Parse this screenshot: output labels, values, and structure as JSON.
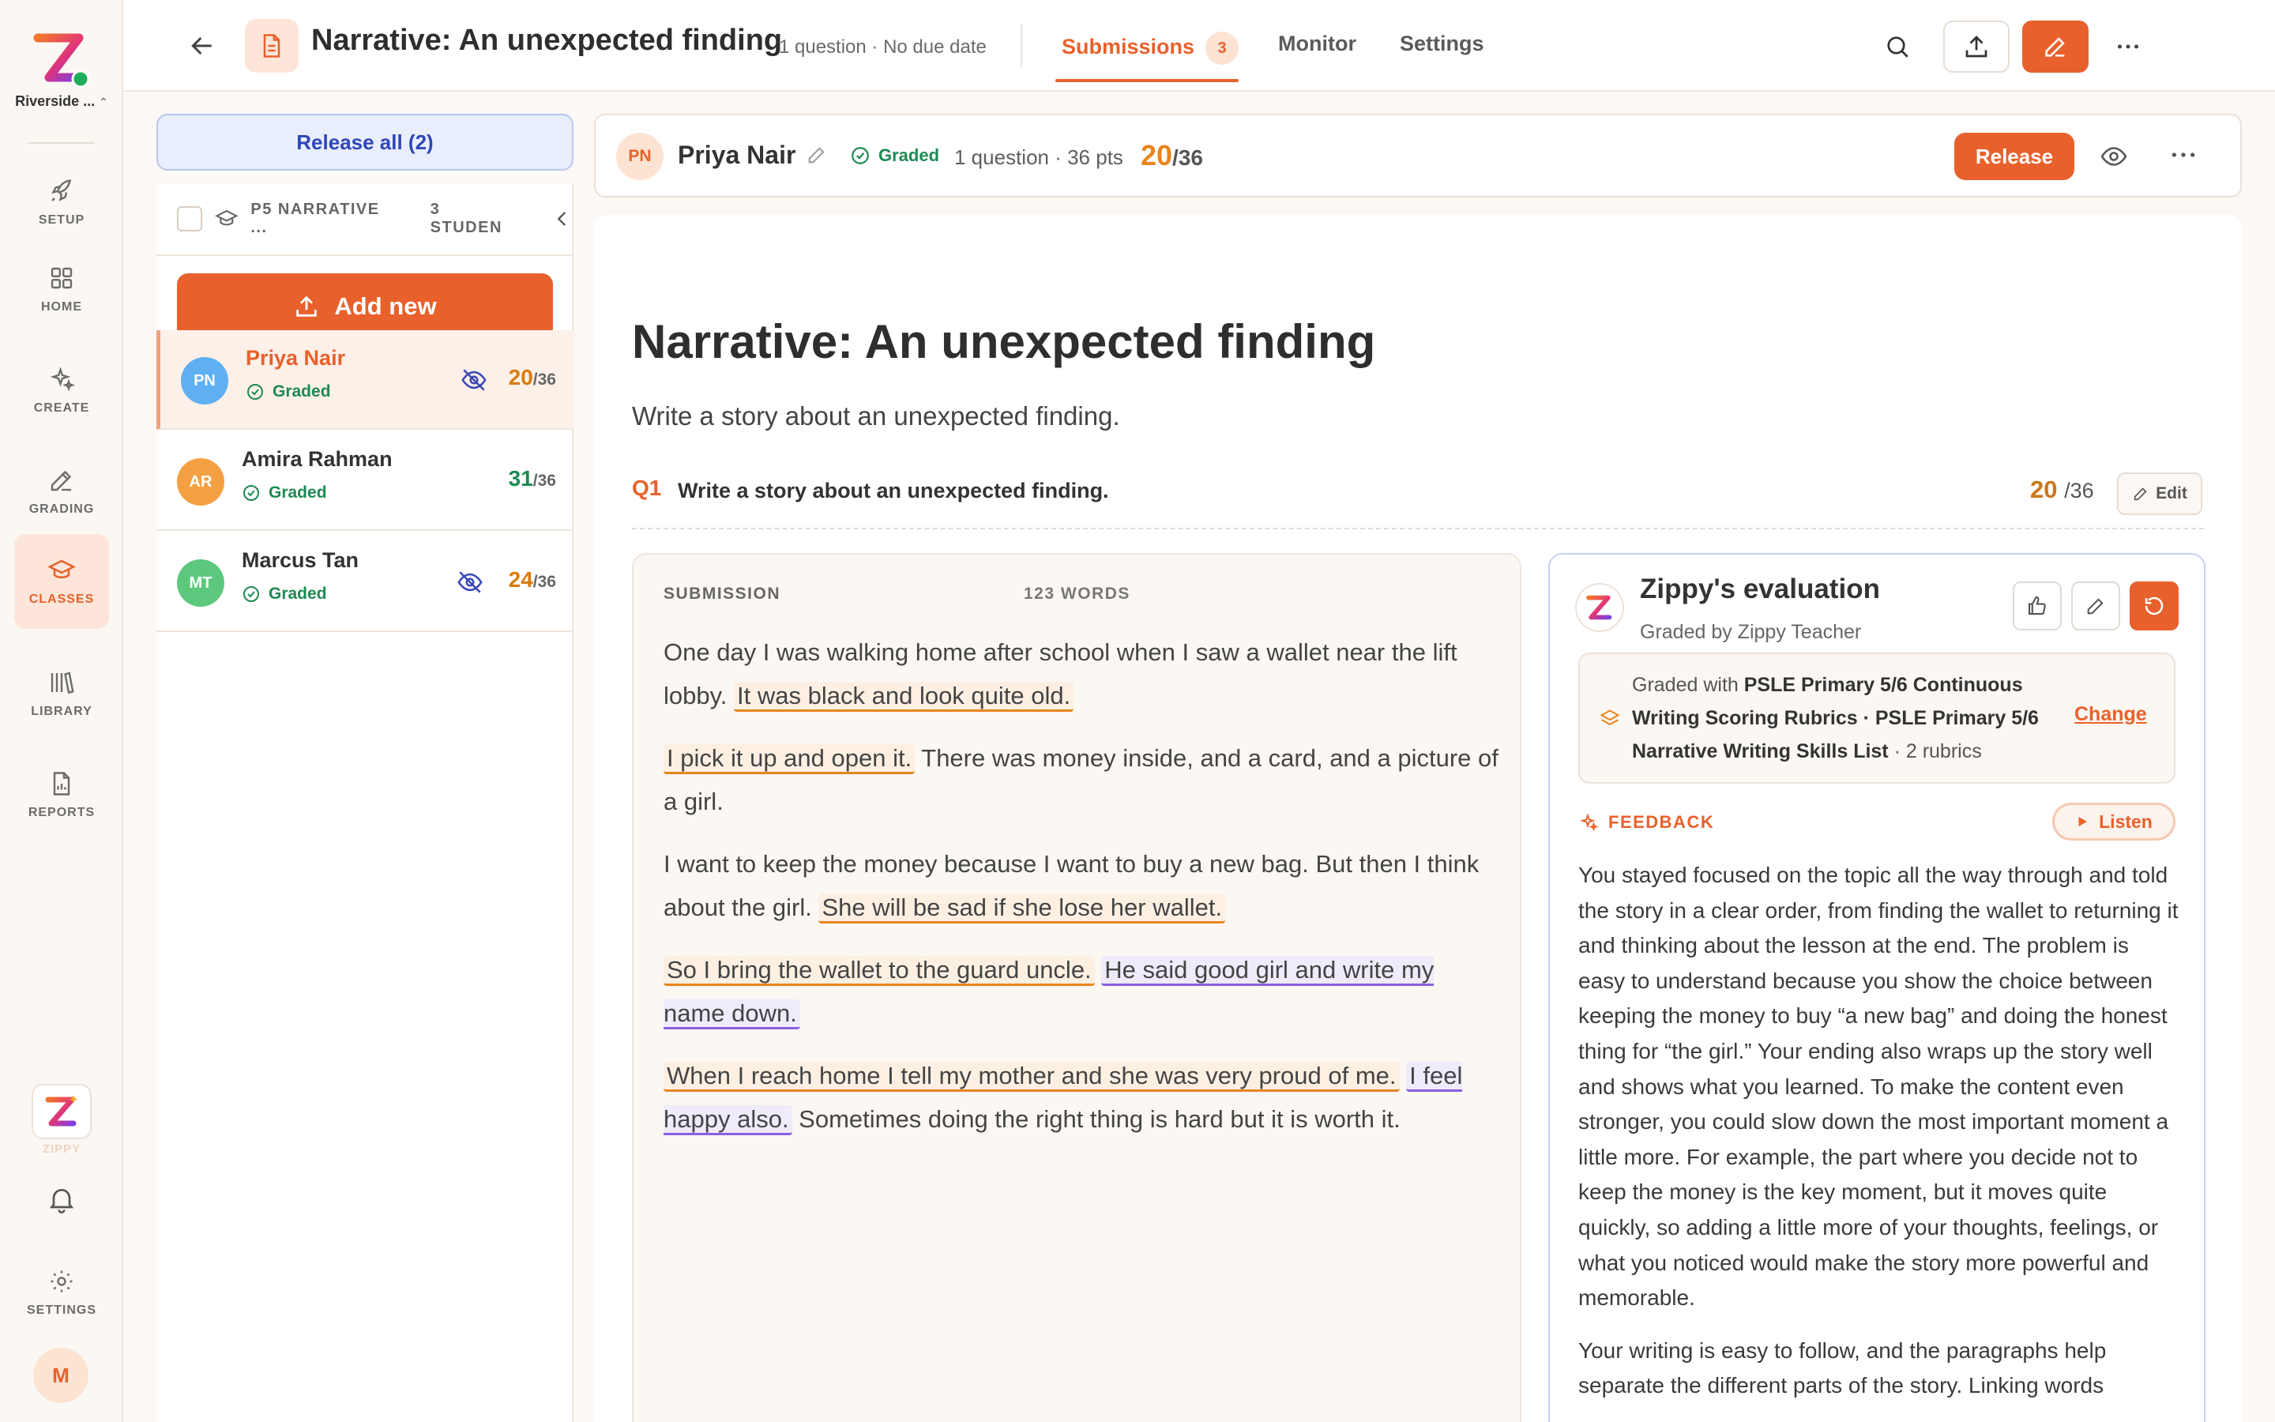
{
  "rail": {
    "school": "Riverside ...",
    "items": [
      {
        "label": "SETUP",
        "icon": "rocket-icon"
      },
      {
        "label": "HOME",
        "icon": "grid-icon"
      },
      {
        "label": "CREATE",
        "icon": "sparkle-icon"
      },
      {
        "label": "GRADING",
        "icon": "pencil-icon"
      },
      {
        "label": "CLASSES",
        "icon": "graduation-cap-icon"
      },
      {
        "label": "LIBRARY",
        "icon": "books-icon"
      },
      {
        "label": "REPORTS",
        "icon": "report-icon"
      }
    ],
    "zippy_label": "ZIPPY",
    "settings_label": "SETTINGS",
    "user_initial": "M"
  },
  "topbar": {
    "title": "Narrative: An unexpected finding",
    "meta": "1 question · No due date",
    "tabs": [
      {
        "label": "Submissions",
        "badge": "3"
      },
      {
        "label": "Monitor"
      },
      {
        "label": "Settings"
      }
    ]
  },
  "students": {
    "release_all": "Release all (2)",
    "class_name": "P5 NARRATIVE ...",
    "class_count": "3 STUDEN",
    "add_new": "Add new",
    "list": [
      {
        "initials": "PN",
        "name": "Priya Nair",
        "status": "Graded",
        "score": "20",
        "total": "/36",
        "color": "#5fb0f2",
        "score_color": "#d97b0f",
        "hidden": true
      },
      {
        "initials": "AR",
        "name": "Amira Rahman",
        "status": "Graded",
        "score": "31",
        "total": "/36",
        "color": "#f4a042",
        "score_color": "#1d8a52",
        "hidden": false
      },
      {
        "initials": "MT",
        "name": "Marcus Tan",
        "status": "Graded",
        "score": "24",
        "total": "/36",
        "color": "#5cc87e",
        "score_color": "#d97b0f",
        "hidden": true
      }
    ]
  },
  "header": {
    "initials": "PN",
    "name": "Priya Nair",
    "status": "Graded",
    "meta": "1 question · 36 pts",
    "score": "20",
    "total": "/36",
    "release": "Release"
  },
  "assignment": {
    "title": "Narrative: An unexpected finding",
    "description": "Write a story about an unexpected finding.",
    "q_label": "Q1",
    "q_text": "Write a story about an unexpected finding.",
    "q_score": "20",
    "q_total": "/36",
    "edit": "Edit"
  },
  "submission": {
    "label": "SUBMISSION",
    "word_count": "123 WORDS",
    "paragraphs": [
      [
        {
          "t": "One day I was walking home after school when I saw a wallet near the lift lobby. "
        },
        {
          "t": "It was black and look quite old.",
          "hl": "o"
        }
      ],
      [
        {
          "t": "I pick it up and open it.",
          "hl": "o"
        },
        {
          "t": " There was money inside, and a card, and a picture of a girl."
        }
      ],
      [
        {
          "t": "I want to keep the money because I want to buy a new bag. But then I think about the girl. "
        },
        {
          "t": "She will be sad if she lose her wallet.",
          "hl": "o"
        }
      ],
      [
        {
          "t": "So I bring the wallet to the guard uncle.",
          "hl": "o"
        },
        {
          "t": " "
        },
        {
          "t": "He said good girl and write my name down.",
          "hl": "p"
        }
      ],
      [
        {
          "t": "When I reach home I tell my mother and she was very proud of me.",
          "hl": "o"
        },
        {
          "t": " "
        },
        {
          "t": "I feel happy also.",
          "hl": "p"
        },
        {
          "t": " Sometimes doing the right thing is hard but it is worth it."
        }
      ]
    ]
  },
  "evaluation": {
    "title": "Zippy's evaluation",
    "graded_by": "Graded by Zippy Teacher",
    "rubric_prefix": "Graded with ",
    "rubric_names": "PSLE Primary 5/6 Continuous Writing Scoring Rubrics · PSLE Primary 5/6 Narrative Writing Skills List",
    "rubric_suffix": " · 2 rubrics",
    "change": "Change",
    "feedback_label": "FEEDBACK",
    "listen": "Listen",
    "feedback": [
      "You stayed focused on the topic all the way through and told the story in a clear order, from finding the wallet to returning it and thinking about the lesson at the end. The problem is easy to understand because you show the choice between keeping the money to buy “a new bag” and doing the honest thing for “the girl.” Your ending also wraps up the story well and shows what you learned. To make the content even stronger, you could slow down the most important moment a little more. For example, the part where you decide not to keep the money is the key moment, but it moves quite quickly, so adding a little more of your thoughts, feelings, or what you noticed would make the story more powerful and memorable.",
      "Your writing is easy to follow, and the paragraphs help separate the different parts of the story. Linking words"
    ]
  },
  "colors": {
    "accent": "#e8612c",
    "graded": "#1d8a52",
    "highlight_orange": "#e8851c",
    "highlight_purple": "#8b5fe0"
  }
}
